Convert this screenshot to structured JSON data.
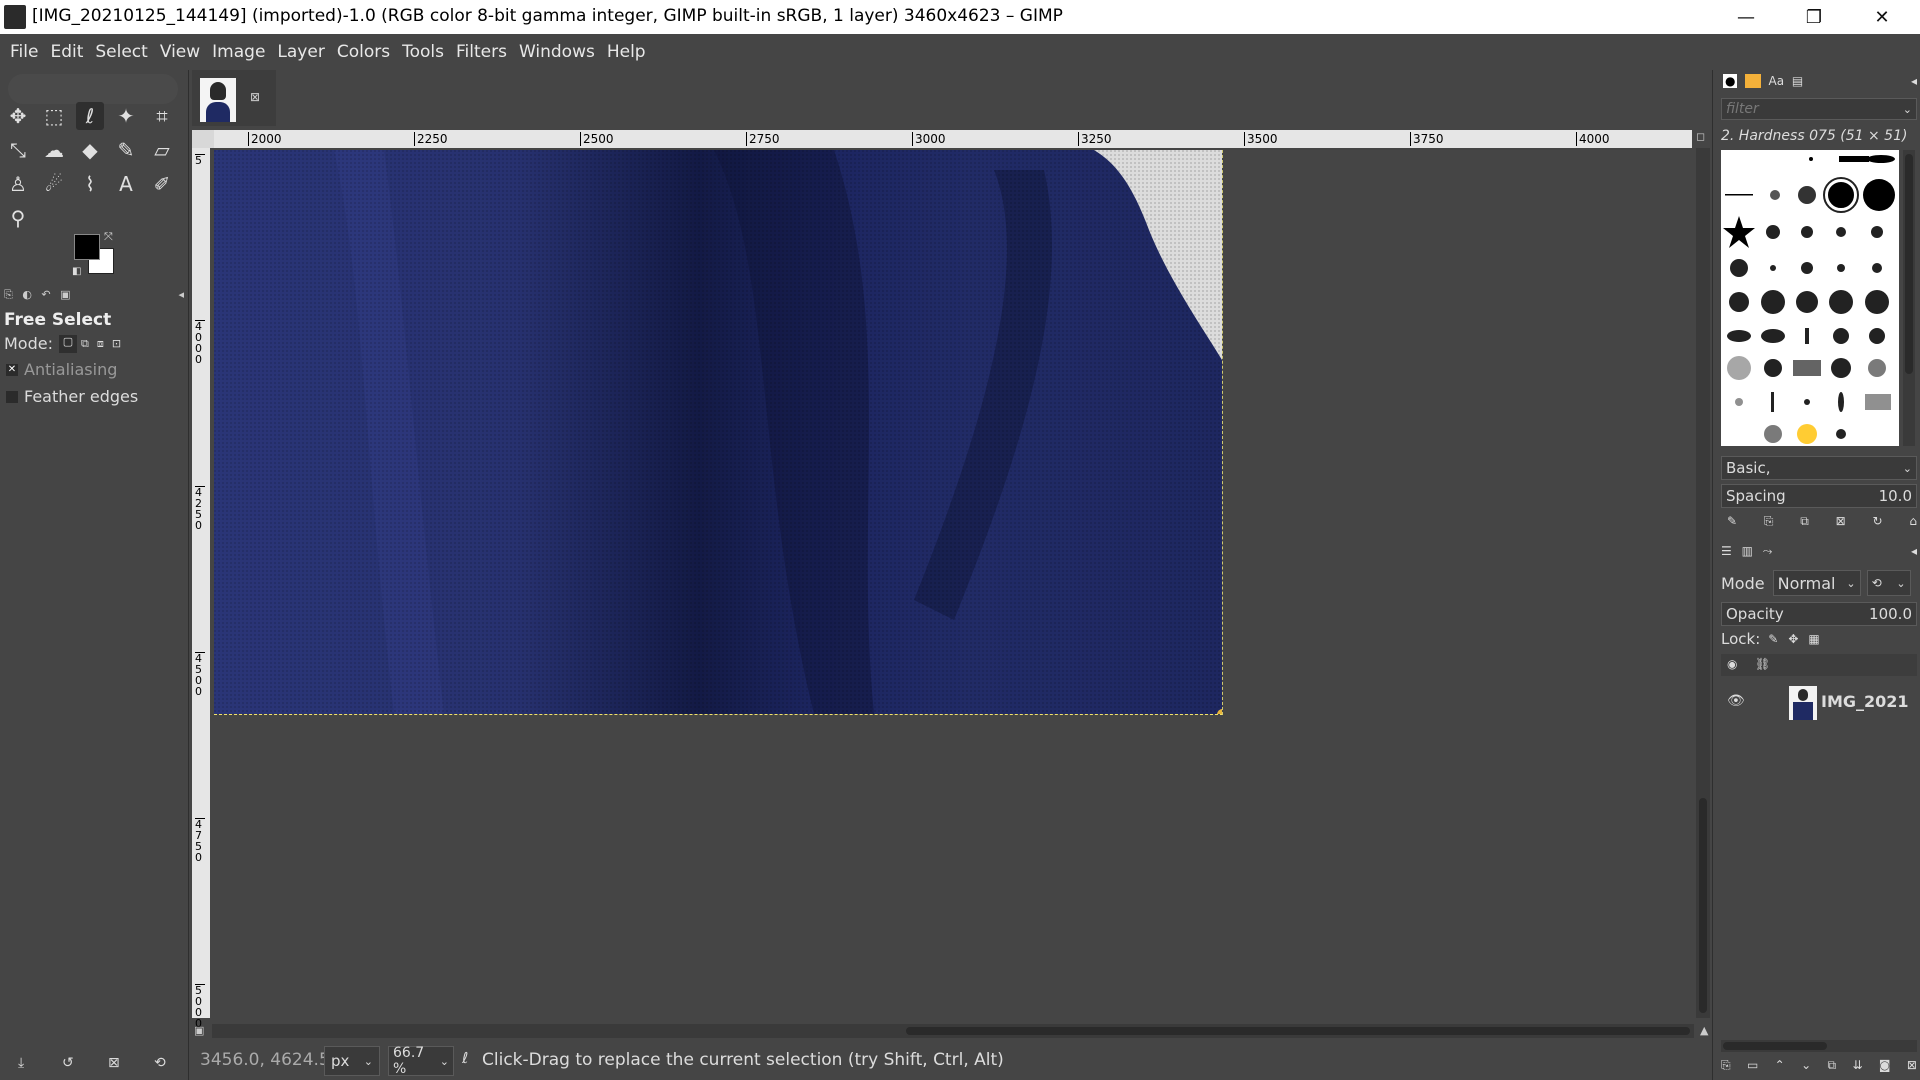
{
  "window": {
    "title": "[IMG_20210125_144149] (imported)-1.0 (RGB color 8-bit gamma integer, GIMP built-in sRGB, 1 layer) 3460x4623 – GIMP",
    "minimize": "—",
    "restore": "❐",
    "close": "✕"
  },
  "menu": [
    "File",
    "Edit",
    "Select",
    "View",
    "Image",
    "Layer",
    "Colors",
    "Tools",
    "Filters",
    "Windows",
    "Help"
  ],
  "tool_options": {
    "title": "Free Select",
    "mode_label": "Mode:",
    "antialiasing": "Antialiasing",
    "feather_edges": "Feather edges"
  },
  "ruler": {
    "h_ticks": [
      "2000",
      "2250",
      "2500",
      "2750",
      "3000",
      "3250",
      "3500",
      "3750",
      "4000"
    ],
    "v_ticks": [
      "5",
      "4000",
      "4250",
      "4500",
      "4750",
      "5000"
    ]
  },
  "brushes": {
    "filter_placeholder": "filter",
    "selected_brush": "2. Hardness 075 (51 × 51)",
    "preset": "Basic,",
    "spacing_label": "Spacing",
    "spacing_value": "10.0"
  },
  "layers": {
    "mode_label": "Mode",
    "mode_value": "Normal",
    "opacity_label": "Opacity",
    "opacity_value": "100.0",
    "lock_label": "Lock:",
    "layer_name": "IMG_2021"
  },
  "status": {
    "coords": "3456.0, 4624.5",
    "unit": "px",
    "zoom": "66.7 %",
    "message": "Click-Drag to replace the current selection (try Shift, Ctrl, Alt)"
  },
  "colors": {
    "bg": "#454545",
    "cloth": "#1f2a63",
    "selection": "#f1e26a"
  }
}
